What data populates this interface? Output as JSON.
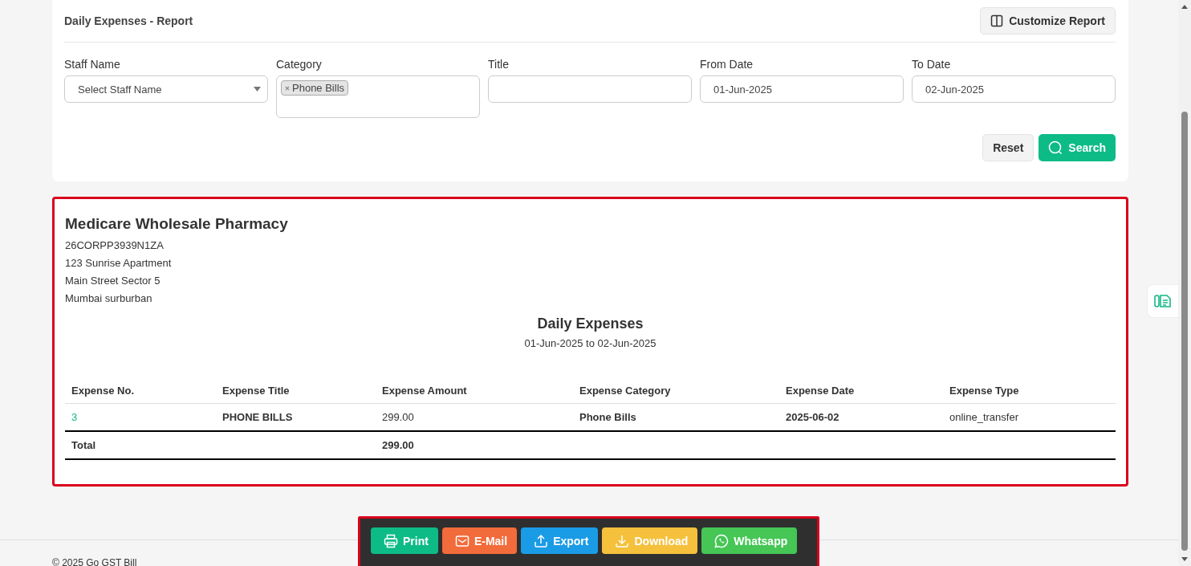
{
  "header": {
    "title": "Daily Expenses - Report",
    "customize_button": "Customize Report"
  },
  "filters": [
    {
      "kind": "select",
      "label": "Staff Name",
      "placeholder": "Select Staff Name"
    },
    {
      "kind": "tags",
      "label": "Category",
      "tags": [
        "Phone Bills"
      ]
    },
    {
      "kind": "text",
      "label": "Title"
    },
    {
      "kind": "text",
      "label": "From Date",
      "value": "01-Jun-2025"
    },
    {
      "kind": "text",
      "label": "To Date",
      "value": "02-Jun-2025"
    }
  ],
  "filter_buttons": {
    "reset": "Reset",
    "search": "Search"
  },
  "report": {
    "company": "Medicare Wholesale Pharmacy",
    "address_lines": [
      "26CORPP3939N1ZA",
      "123 Sunrise Apartment",
      "Main Street Sector 5",
      "Mumbai surburban"
    ],
    "title": "Daily Expenses",
    "period": "01-Jun-2025 to 02-Jun-2025",
    "columns": [
      "Expense No.",
      "Expense Title",
      "Expense Amount",
      "Expense Category",
      "Expense Date",
      "Expense Type"
    ],
    "rows": [
      {
        "cells": [
          "3",
          "PHONE BILLS",
          "299.00",
          "Phone Bills",
          "2025-06-02",
          "online_transfer"
        ]
      }
    ],
    "total": {
      "label": "Total",
      "amount": "299.00"
    }
  },
  "actions": [
    {
      "kind": "print",
      "label": "Print",
      "color": "#0dbb86"
    },
    {
      "kind": "email",
      "label": "E-Mail",
      "color": "#f26b3a"
    },
    {
      "kind": "export",
      "label": "Export",
      "color": "#1a9be6"
    },
    {
      "kind": "download",
      "label": "Download",
      "color": "#f5c03b"
    },
    {
      "kind": "whatsapp",
      "label": "Whatsapp",
      "color": "#45c655"
    }
  ],
  "footer": {
    "copyright": "© 2025 Go GST Bill"
  }
}
